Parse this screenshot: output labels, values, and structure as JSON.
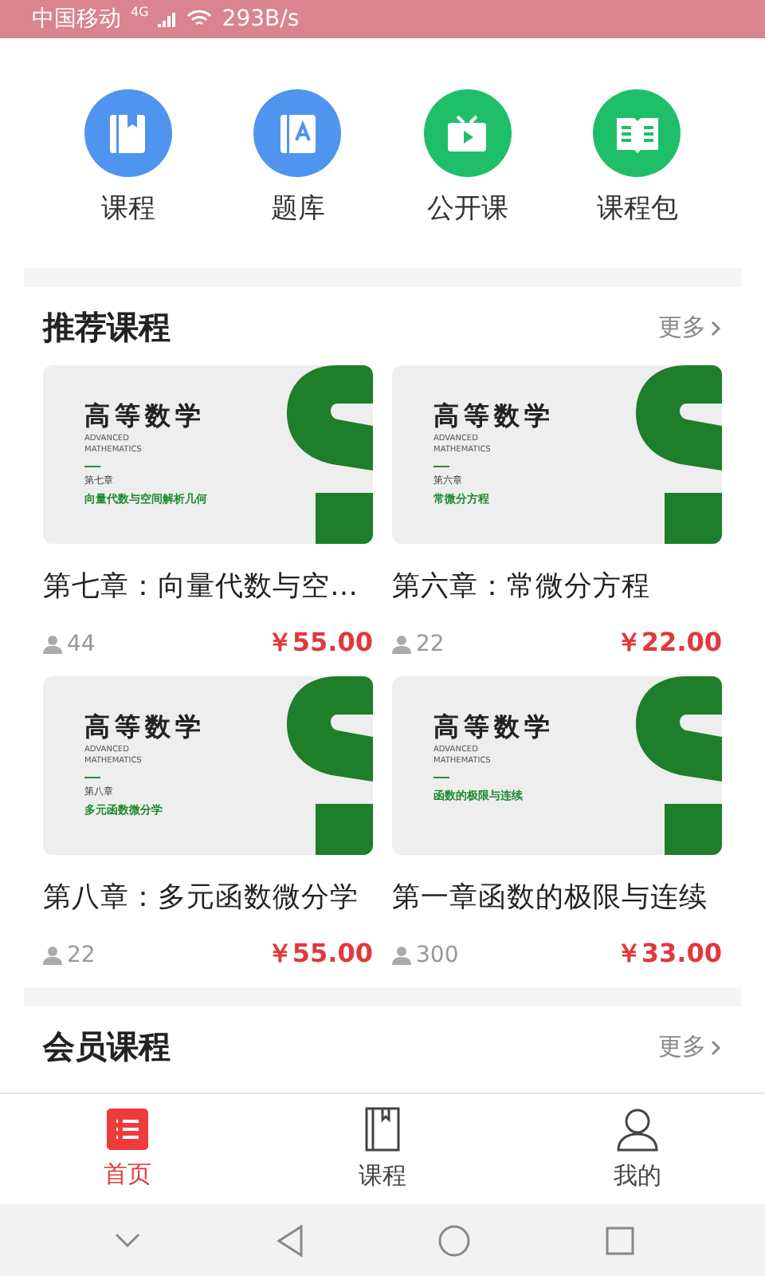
{
  "status_bar": {
    "carrier": "中国移动",
    "network": "4G",
    "speed": "293B/s"
  },
  "quick_menu": [
    {
      "label": "课程",
      "kind": "course"
    },
    {
      "label": "题库",
      "kind": "bank"
    },
    {
      "label": "公开课",
      "kind": "open"
    },
    {
      "label": "课程包",
      "kind": "package"
    }
  ],
  "sections": [
    {
      "title": "推荐课程",
      "more": "更多",
      "courses": [
        {
          "cover": {
            "title": "高等数学",
            "subtitle_1": "ADVANCED",
            "subtitle_2": "MATHEMATICS",
            "chapter": "第七章",
            "topic": "向量代数与空间解析几何"
          },
          "title": "第七章：向量代数与空…",
          "students": "44",
          "price": "￥55.00"
        },
        {
          "cover": {
            "title": "高等数学",
            "subtitle_1": "ADVANCED",
            "subtitle_2": "MATHEMATICS",
            "chapter": "第六章",
            "topic": "常微分方程"
          },
          "title": "第六章：常微分方程",
          "students": "22",
          "price": "￥22.00"
        },
        {
          "cover": {
            "title": "高等数学",
            "subtitle_1": "ADVANCED",
            "subtitle_2": "MATHEMATICS",
            "chapter": "第八章",
            "topic": "多元函数微分学"
          },
          "title": "第八章：多元函数微分学",
          "students": "22",
          "price": "￥55.00"
        },
        {
          "cover": {
            "title": "高等数学",
            "subtitle_1": "ADVANCED",
            "subtitle_2": "MATHEMATICS",
            "topic": "函数的极限与连续"
          },
          "title": "第一章函数的极限与连续",
          "students": "300",
          "price": "￥33.00"
        }
      ]
    },
    {
      "title": "会员课程",
      "more": "更多"
    }
  ],
  "tab_bar": [
    {
      "label": "首页",
      "kind": "home",
      "selected": true
    },
    {
      "label": "课程",
      "kind": "course",
      "selected": false
    },
    {
      "label": "我的",
      "kind": "profile",
      "selected": false
    }
  ]
}
